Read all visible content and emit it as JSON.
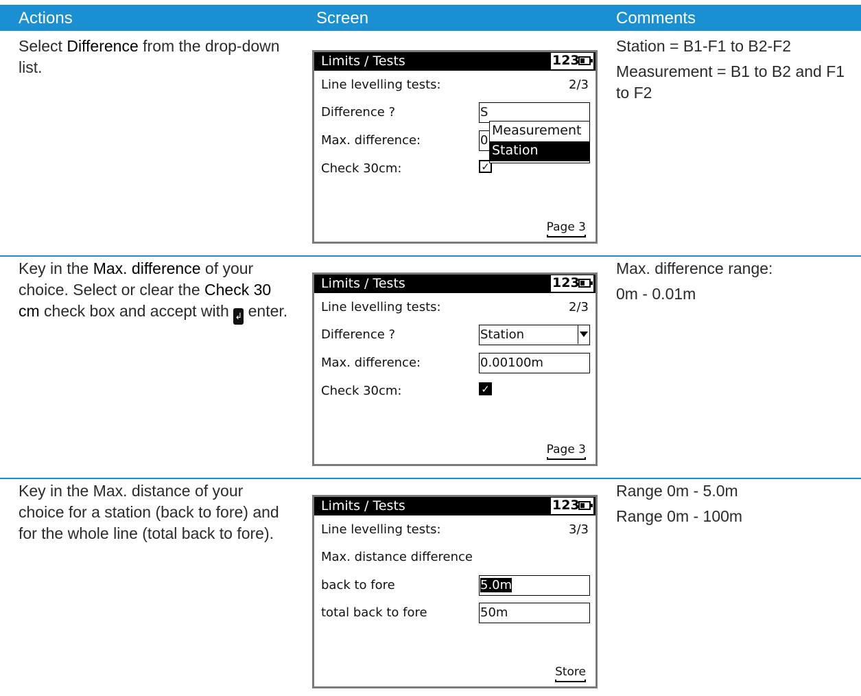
{
  "header": {
    "actions": "Actions",
    "screen": "Screen",
    "comments": "Comments"
  },
  "colors": {
    "accent": "#1a8fd1"
  },
  "rows": [
    {
      "action": {
        "p1": "Select ",
        "b1": "Difference",
        "p2": " from the drop-down list."
      },
      "comments": [
        "Station = B1-F1 to B2-F2",
        "Measurement = B1 to B2 and F1 to F2"
      ],
      "screen": {
        "title": "Limits / Tests",
        "mode": "123",
        "line_label": "Line levelling tests:",
        "page_indicator": "2/3",
        "difference_label": "Difference ?",
        "difference_partial": "S",
        "max_diff_label": "Max. difference:",
        "max_diff_partial": "0.0",
        "check_label": "Check 30cm:",
        "check_mark": "✓",
        "dropdown_options": [
          "Measurement",
          "Station"
        ],
        "dropdown_selected": "Station",
        "softkey": "Page 3"
      }
    },
    {
      "action": {
        "p1": "Key in the ",
        "b1": "Max. difference",
        "p2": " of your choice. Select or clear the ",
        "b2": "Check 30 cm",
        "p3": " check box and accept with ",
        "key": "↲",
        "p4": " enter."
      },
      "comments": [
        "Max. difference range:",
        "0m - 0.01m"
      ],
      "screen": {
        "title": "Limits / Tests",
        "mode": "123",
        "line_label": "Line levelling tests:",
        "page_indicator": "2/3",
        "difference_label": "Difference ?",
        "difference_value": "Station",
        "max_diff_label": "Max. difference:",
        "max_diff_value": "0.00100m",
        "check_label": "Check 30cm:",
        "check_mark": "✓",
        "softkey": "Page 3"
      }
    },
    {
      "action": {
        "p1": "Key in the Max. distance of your choice for a station (back to fore) and for the whole line (total back to fore)."
      },
      "comments": [
        "Range 0m - 5.0m",
        "Range 0m - 100m"
      ],
      "screen": {
        "title": "Limits / Tests",
        "mode": "123",
        "line_label": "Line levelling tests:",
        "page_indicator": "3/3",
        "max_dist_label": "Max. distance difference",
        "back_fore_label": "back to fore",
        "back_fore_value": "5.0m",
        "total_back_fore_label": "total back to fore",
        "total_back_fore_value": "50m",
        "softkey": "Store"
      }
    }
  ]
}
